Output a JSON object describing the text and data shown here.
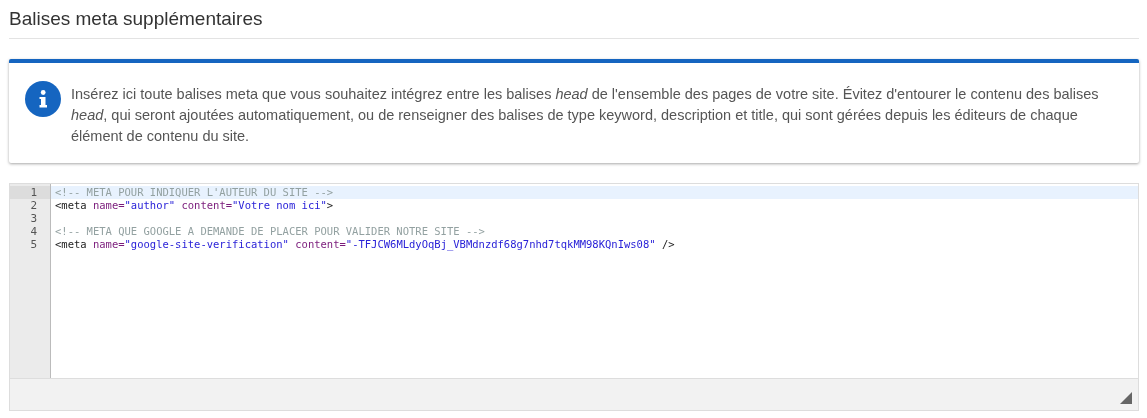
{
  "title": "Balises meta supplémentaires",
  "info": {
    "text": "Insérez ici toute balises meta que vous souhaitez intégrez entre les balises *head* de l'ensemble des pages de votre site. Évitez d'entourer le contenu des balises *head*, qui seront ajoutées automatiquement, ou de renseigner des balises de type keyword, description et title, qui sont gérées depuis les éditeurs de chaque élément de contenu du site."
  },
  "editor": {
    "lines": [
      {
        "number": "1",
        "active": true,
        "tokens": [
          {
            "kind": "comment",
            "text": "<!-- META POUR INDIQUER L'AUTEUR DU SITE -->"
          }
        ]
      },
      {
        "number": "2",
        "active": false,
        "tokens": [
          {
            "kind": "tag",
            "text": "<meta"
          },
          {
            "kind": "attr",
            "text": " name="
          },
          {
            "kind": "string",
            "text": "\"author\""
          },
          {
            "kind": "attr",
            "text": " content="
          },
          {
            "kind": "string",
            "text": "\"Votre nom ici\""
          },
          {
            "kind": "tag",
            "text": ">"
          }
        ]
      },
      {
        "number": "3",
        "active": false
      },
      {
        "number": "4",
        "active": false,
        "tokens": [
          {
            "kind": "comment",
            "text": "<!-- META QUE GOOGLE A DEMANDE DE PLACER POUR VALIDER NOTRE SITE -->"
          }
        ]
      },
      {
        "number": "5",
        "active": false,
        "tokens": [
          {
            "kind": "tag",
            "text": "<meta"
          },
          {
            "kind": "attr",
            "text": " name="
          },
          {
            "kind": "string",
            "text": "\"google-site-verification\""
          },
          {
            "kind": "attr",
            "text": " content="
          },
          {
            "kind": "string",
            "text": "\"-TFJCW6MLdyOqBj_VBMdnzdf68g7nhd7tqkMM98KQnIws08\""
          },
          {
            "kind": "tag",
            "text": " />"
          }
        ]
      }
    ]
  }
}
